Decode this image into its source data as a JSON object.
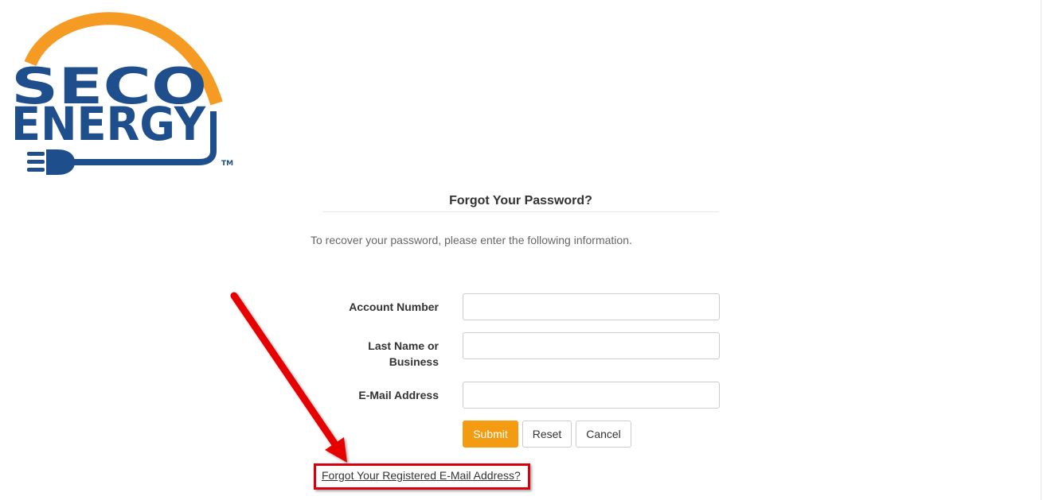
{
  "logo": {
    "line1": "SECO",
    "line2": "ENERGY",
    "trademark": "TM",
    "colors": {
      "blue": "#1f4e8c",
      "orange": "#f59b23"
    }
  },
  "page": {
    "title": "Forgot Your Password?",
    "instructions": "To recover your password, please enter the following information."
  },
  "form": {
    "account_number": {
      "label": "Account Number",
      "value": ""
    },
    "last_name": {
      "label_line1": "Last Name or",
      "label_line2": "Business",
      "value": ""
    },
    "email": {
      "label": "E-Mail Address",
      "value": ""
    }
  },
  "buttons": {
    "submit": "Submit",
    "reset": "Reset",
    "cancel": "Cancel"
  },
  "links": {
    "forgot_email": "Forgot Your Registered E-Mail Address?"
  },
  "annotation": {
    "arrow_color": "#e60000",
    "highlight_color": "#d8000c"
  },
  "colors": {
    "accent": "#f39c12",
    "text": "#333333",
    "muted": "#666666"
  }
}
